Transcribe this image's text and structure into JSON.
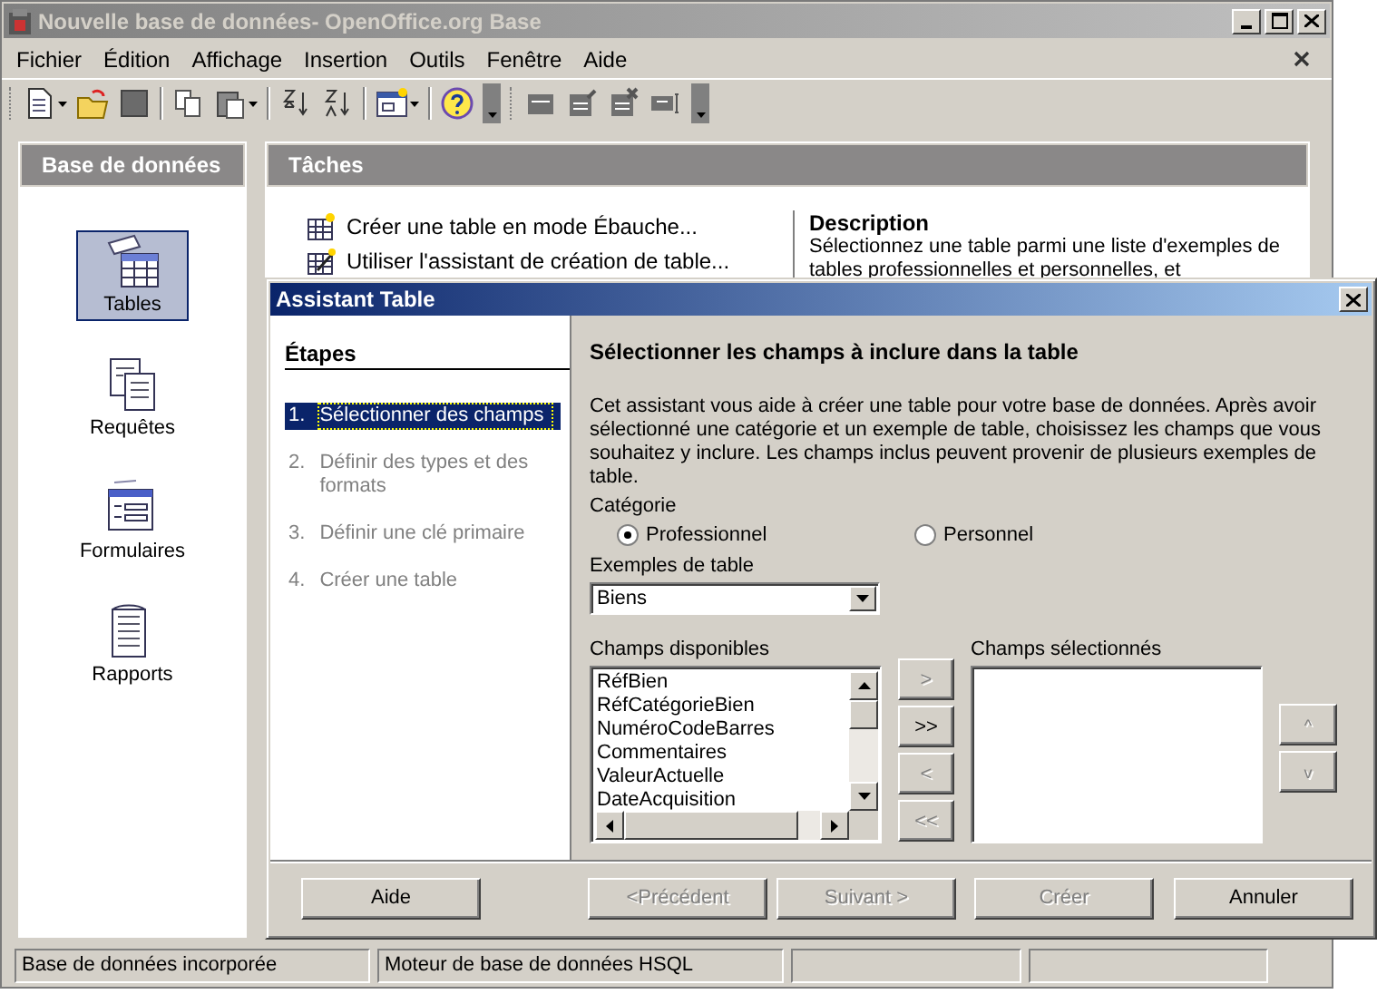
{
  "window": {
    "title": "Nouvelle base de données- OpenOffice.org Base"
  },
  "menu": [
    "Fichier",
    "Édition",
    "Affichage",
    "Insertion",
    "Outils",
    "Fenêtre",
    "Aide"
  ],
  "sidebar": {
    "title": "Base de données",
    "items": [
      {
        "label": "Tables",
        "selected": true
      },
      {
        "label": "Requêtes",
        "selected": false
      },
      {
        "label": "Formulaires",
        "selected": false
      },
      {
        "label": "Rapports",
        "selected": false
      }
    ]
  },
  "tasks": {
    "title": "Tâches",
    "items": [
      "Créer une table en mode Ébauche...",
      "Utiliser l'assistant de création de table..."
    ],
    "description": {
      "title": "Description",
      "text": "Sélectionnez une table parmi une liste d'exemples de tables professionnelles et personnelles, et"
    }
  },
  "dialog": {
    "title": "Assistant Table",
    "steps_title": "Étapes",
    "steps": [
      {
        "number": "1.",
        "label": "Sélectionner des champs",
        "selected": true
      },
      {
        "number": "2.",
        "label": "Définir des types et des formats",
        "selected": false
      },
      {
        "number": "3.",
        "label": "Définir une clé primaire",
        "selected": false
      },
      {
        "number": "4.",
        "label": "Créer une table",
        "selected": false
      }
    ],
    "heading": "Sélectionner les champs à inclure dans la table",
    "intro": "Cet assistant vous aide à créer une table pour votre base de données. Après avoir sélectionné une catégorie et un exemple de table, choisissez les champs que vous souhaitez y inclure. Les champs inclus peuvent provenir de plusieurs exemples de table.",
    "category": {
      "label": "Catégorie",
      "options": [
        {
          "label": "Professionnel",
          "selected": true
        },
        {
          "label": "Personnel",
          "selected": false
        }
      ]
    },
    "examples": {
      "label": "Exemples de table",
      "value": "Biens"
    },
    "available": {
      "label": "Champs disponibles",
      "items": [
        "RéfBien",
        "RéfCatégorieBien",
        "NuméroCodeBarres",
        "Commentaires",
        "ValeurActuelle",
        "DateAcquisition"
      ]
    },
    "move_buttons": [
      {
        "label": ">",
        "disabled": true
      },
      {
        "label": ">>",
        "disabled": false
      },
      {
        "label": "<",
        "disabled": true
      },
      {
        "label": "<<",
        "disabled": true
      }
    ],
    "chosen": {
      "label": "Champs sélectionnés"
    },
    "order_buttons": [
      {
        "label": "^",
        "disabled": true
      },
      {
        "label": "v",
        "disabled": true
      }
    ],
    "buttons": [
      {
        "label": "Aide",
        "disabled": false
      },
      {
        "label": "<Précédent",
        "disabled": true
      },
      {
        "label": "Suivant >",
        "disabled": true
      },
      {
        "label": "Créer",
        "disabled": true
      },
      {
        "label": "Annuler",
        "disabled": false
      }
    ]
  },
  "status_bar": [
    "Base de données incorporée",
    "Moteur de base de données HSQL"
  ]
}
